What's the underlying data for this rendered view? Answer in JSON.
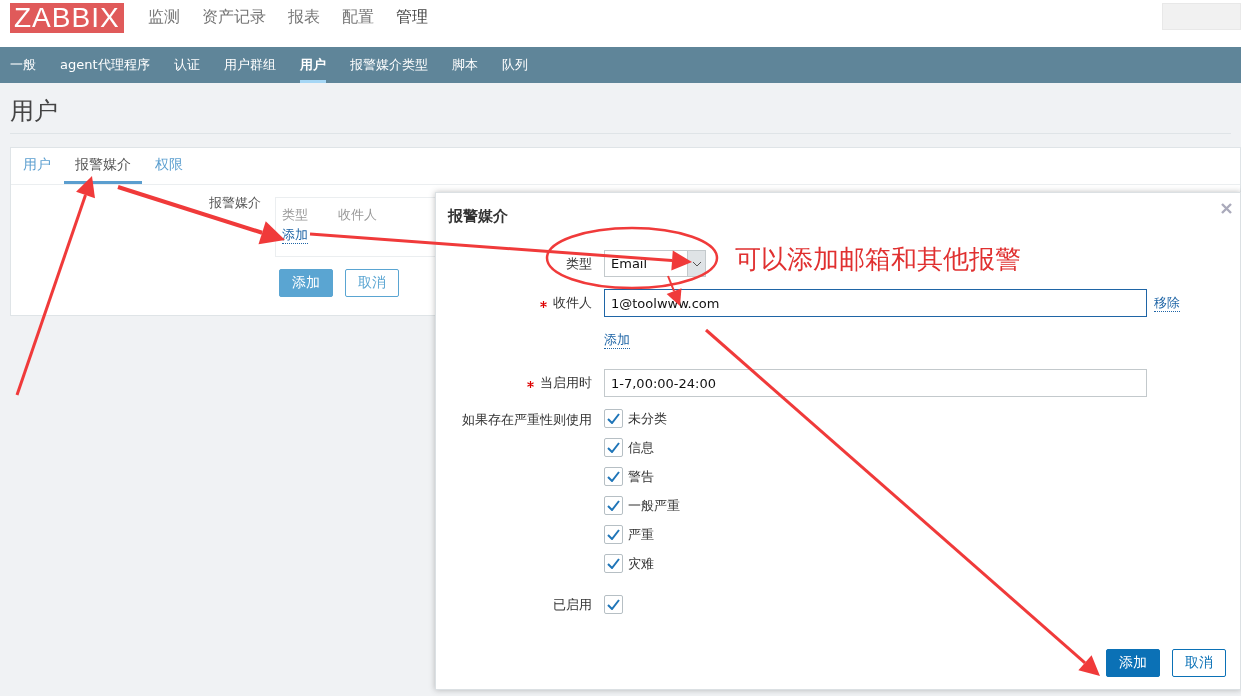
{
  "header": {
    "logo": "ZABBIX",
    "menu": [
      {
        "label": "监测",
        "selected": false
      },
      {
        "label": "资产记录",
        "selected": false
      },
      {
        "label": "报表",
        "selected": false
      },
      {
        "label": "配置",
        "selected": false
      },
      {
        "label": "管理",
        "selected": true
      }
    ]
  },
  "subnav": [
    {
      "label": "一般",
      "selected": false
    },
    {
      "label": "agent代理程序",
      "selected": false
    },
    {
      "label": "认证",
      "selected": false
    },
    {
      "label": "用户群组",
      "selected": false
    },
    {
      "label": "用户",
      "selected": true
    },
    {
      "label": "报警媒介类型",
      "selected": false
    },
    {
      "label": "脚本",
      "selected": false
    },
    {
      "label": "队列",
      "selected": false
    }
  ],
  "page_title": "用户",
  "tabs": [
    {
      "label": "用户",
      "selected": false
    },
    {
      "label": "报警媒介",
      "selected": true
    },
    {
      "label": "权限",
      "selected": false
    }
  ],
  "media_form": {
    "label": "报警媒介",
    "columns": [
      "类型",
      "收件人"
    ],
    "add_link": "添加",
    "buttons": [
      {
        "label": "添加",
        "primary": true
      },
      {
        "label": "取消",
        "primary": false
      }
    ]
  },
  "dialog": {
    "title": "报警媒介",
    "type": {
      "label": "类型",
      "value": "Email"
    },
    "recipient": {
      "label": "收件人",
      "required": true,
      "value": "1@toolwww.com",
      "remove": "移除"
    },
    "add_link": "添加",
    "active": {
      "label": "当启用时",
      "required": true,
      "value": "1-7,00:00-24:00"
    },
    "severity": {
      "label": "如果存在严重性则使用",
      "options": [
        {
          "label": "未分类",
          "checked": true
        },
        {
          "label": "信息",
          "checked": true
        },
        {
          "label": "警告",
          "checked": true
        },
        {
          "label": "一般严重",
          "checked": true
        },
        {
          "label": "严重",
          "checked": true
        },
        {
          "label": "灾难",
          "checked": true
        }
      ]
    },
    "enabled": {
      "label": "已启用",
      "checked": true
    },
    "buttons": [
      {
        "label": "添加",
        "primary": true
      },
      {
        "label": "取消",
        "primary": false
      }
    ]
  },
  "annotation": {
    "text": "可以添加邮箱和其他报警"
  }
}
